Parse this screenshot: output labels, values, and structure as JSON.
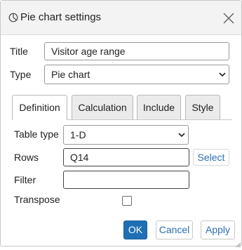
{
  "dialog": {
    "title": "Pie chart settings",
    "icon": "pie-chart-icon",
    "close_icon": "close-icon"
  },
  "form": {
    "title_label": "Title",
    "title_value": "Visitor age range",
    "type_label": "Type",
    "type_value": "Pie chart"
  },
  "tabs": [
    {
      "label": "Definition",
      "active": true
    },
    {
      "label": "Calculation",
      "active": false
    },
    {
      "label": "Include",
      "active": false
    },
    {
      "label": "Style",
      "active": false
    }
  ],
  "definition": {
    "table_type_label": "Table type",
    "table_type_value": "1-D",
    "rows_label": "Rows",
    "rows_value": "Q14",
    "select_link": "Select",
    "filter_label": "Filter",
    "filter_value": "",
    "transpose_label": "Transpose",
    "transpose_checked": false
  },
  "buttons": {
    "ok": "OK",
    "cancel": "Cancel",
    "apply": "Apply"
  },
  "colors": {
    "primary": "#1f6fb5",
    "link": "#2a6db5"
  }
}
